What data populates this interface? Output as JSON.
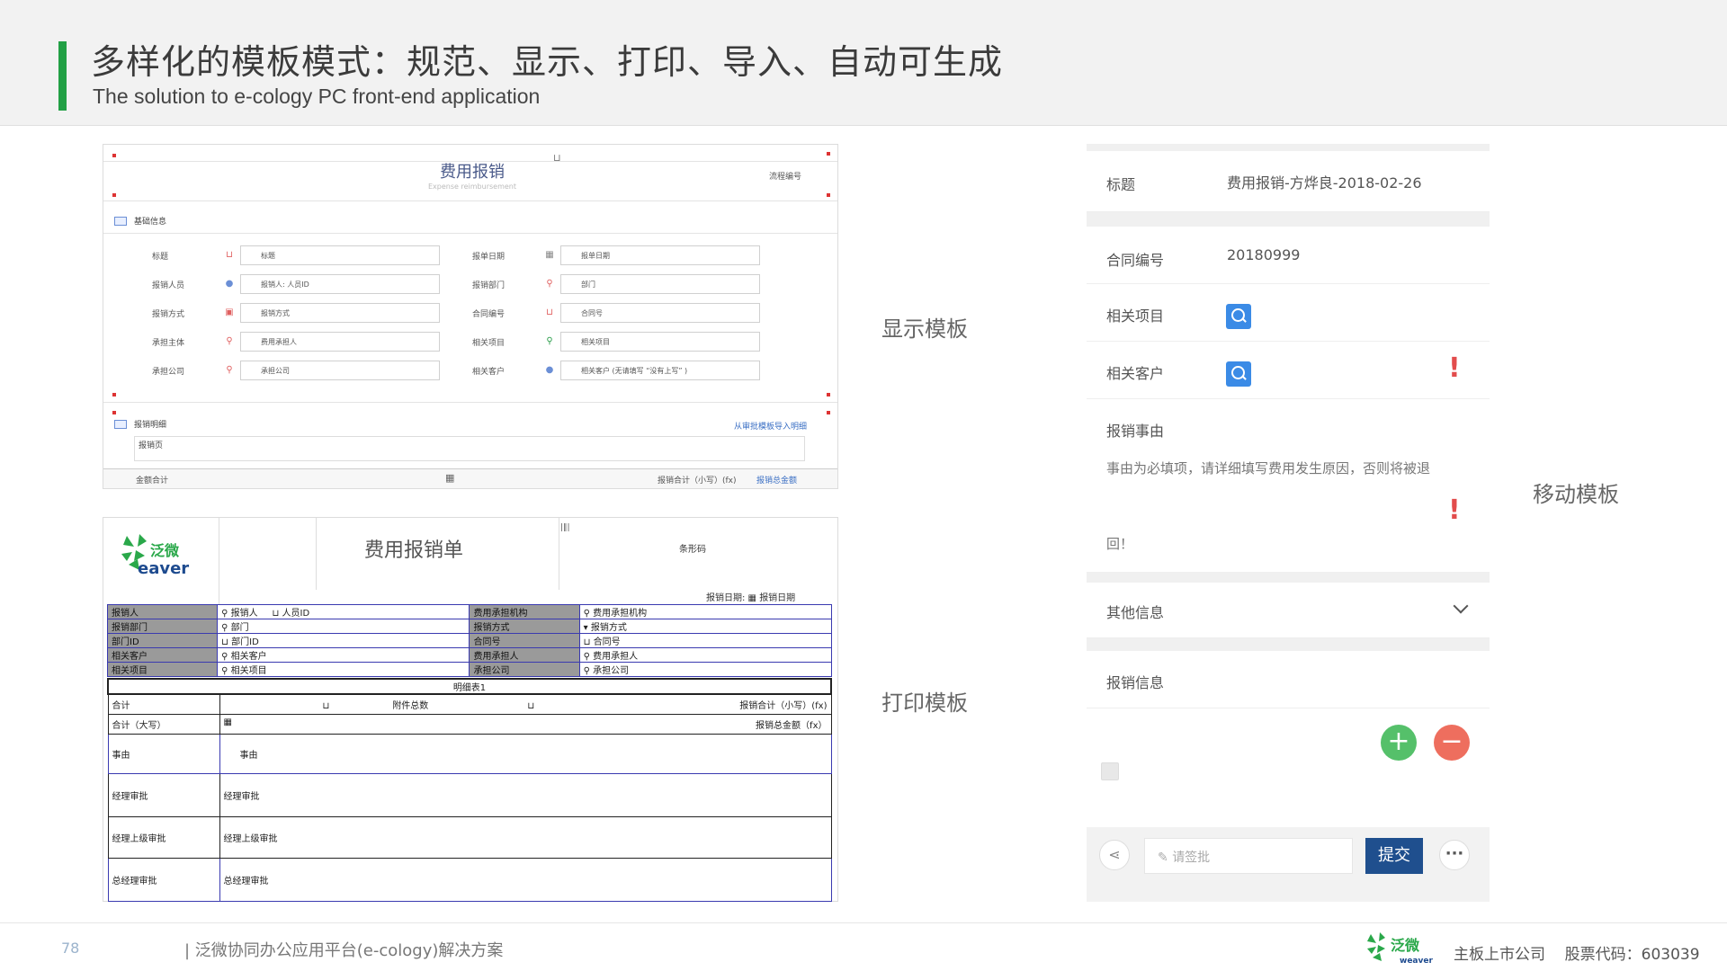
{
  "header": {
    "title": "多样化的模板模式：规范、显示、打印、导入、自动可生成",
    "subtitle": "The solution to e-cology PC front-end application"
  },
  "labels": {
    "display": "显示模板",
    "print": "打印模板",
    "mobile": "移动模板"
  },
  "display": {
    "title": "费用报销",
    "subtitle": "Expense reimbursement",
    "code": "流程编号",
    "section1": "基础信息",
    "fields_left": [
      {
        "label": "标题",
        "value": "标题"
      },
      {
        "label": "报销人员",
        "value": "报销人: 人员ID"
      },
      {
        "label": "报销方式",
        "value": "报销方式"
      },
      {
        "label": "承担主体",
        "value": "费用承担人"
      },
      {
        "label": "承担公司",
        "value": "承担公司"
      }
    ],
    "fields_right": [
      {
        "label": "报单日期",
        "value": "报单日期"
      },
      {
        "label": "报销部门",
        "value": "部门"
      },
      {
        "label": "合同编号",
        "value": "合同号"
      },
      {
        "label": "相关项目",
        "value": "相关项目"
      },
      {
        "label": "相关客户",
        "value": "相关客户 (无请填写 “没有上写” )"
      }
    ],
    "section2": "报销明细",
    "import_link": "从审批模板导入明细",
    "detail_row": "报销页",
    "total_label": "金额合计",
    "total_right": "报销合计（小写）(fx)",
    "total_right2": "报销总金额"
  },
  "print": {
    "logo_text": "泛微",
    "logo_sub": "eaver",
    "title": "费用报销单",
    "code": "条形码",
    "date_label": "报销日期:",
    "date_value": "报销日期",
    "rows": [
      [
        "报销人",
        "报销人",
        "人员ID",
        "费用承担机构",
        "费用承担机构"
      ],
      [
        "报销部门",
        "部门",
        "",
        "报销方式",
        "报销方式"
      ],
      [
        "部门ID",
        "部门ID",
        "",
        "合同号",
        "合同号"
      ],
      [
        "相关客户",
        "相关客户",
        "",
        "费用承担人",
        "费用承担人"
      ],
      [
        "相关项目",
        "相关项目",
        "",
        "承担公司",
        "承担公司"
      ]
    ],
    "detail_caption": "明细表1",
    "sum_label": "合计",
    "sum_mid": "附件总数",
    "sum_right": "报销合计（小写）(fx)",
    "sum_upper_label": "合计（大写）",
    "sum_upper_right": "报销总金额（fx）",
    "reason_label": "事由",
    "reason_value": "事由",
    "mgr_label": "经理审批",
    "mgr_value": "经理审批",
    "mgr2_label": "经理上级审批",
    "mgr2_value": "经理上级审批",
    "gm_label": "总经理审批",
    "gm_value": "总经理审批"
  },
  "mobile": {
    "title_label": "标题",
    "title_value": "费用报销-方烨良-2018-02-26",
    "contract_label": "合同编号",
    "contract_value": "20180999",
    "project_label": "相关项目",
    "customer_label": "相关客户",
    "reason_label": "报销事由",
    "reason_text": "事由为必填项，请详细填写费用发生原因，否则将被退",
    "reason_text2": "回！",
    "other_label": "其他信息",
    "info_label": "报销信息",
    "sign_placeholder": "请签批",
    "submit_label": "提交"
  },
  "footer": {
    "page_number": "78",
    "text": "| 泛微协同办公应用平台(e-cology)解决方案",
    "brand": "泛微",
    "brand_sub": "weaver",
    "company": "主板上市公司",
    "stock": "股票代码：603039"
  },
  "colors": {
    "accent_green": "#22a045",
    "submit_blue": "#1f4f8e",
    "search_blue": "#3b8be6",
    "add_green": "#55c06a",
    "remove_red": "#ee6e5e"
  }
}
